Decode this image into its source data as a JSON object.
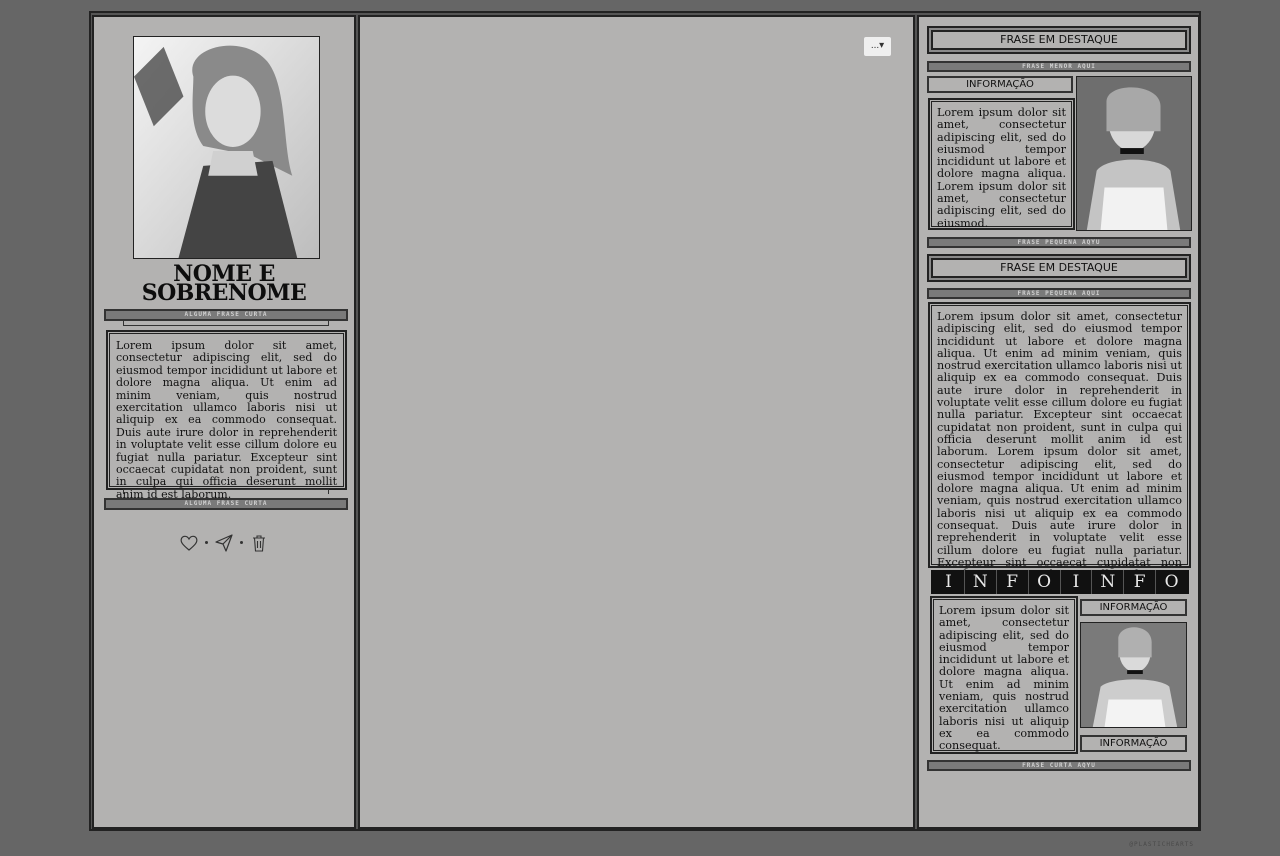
{
  "left_panel": {
    "name": "NOME E SOBRENOME",
    "top_bar_label": "ALGUMA FRASE CURTA",
    "bottom_bar_label": "ALGUMA FRASE CURTA",
    "bio": "Lorem ipsum dolor sit amet, consectetur adipiscing elit, sed do eiusmod tempor incididunt ut labore et dolore magna aliqua. Ut enim ad minim veniam, quis nostrud exercitation ullamco laboris nisi ut aliquip ex ea commodo consequat. Duis aute irure dolor in reprehenderit in voluptate velit esse cillum dolore eu fugiat nulla pariatur. Excepteur sint occaecat cupidatat non proident, sunt in culpa qui officia deserunt mollit anim id est laborum.",
    "actions": [
      {
        "icon": "heart-icon"
      },
      {
        "icon": "send-icon"
      },
      {
        "icon": "trash-icon"
      }
    ]
  },
  "center_panel": {
    "menu_button": "...▾"
  },
  "right_panel": {
    "feature_1": "FRASE EM DESTAQUE",
    "small_phrase_1": "FRASE MENOR AQUI",
    "info_label_1": "INFORMAÇÃO",
    "text_1": "Lorem ipsum dolor sit amet, consectetur adipiscing elit, sed do eiusmod tempor incididunt ut labore et dolore magna aliqua. Lorem ipsum dolor sit amet, consectetur adipiscing elit, sed do eiusmod.",
    "small_phrase_2": "FRASE PEQUENA AQYU",
    "feature_2": "FRASE EM DESTAQUE",
    "small_phrase_3": "FRASE PEQUENA AQUI",
    "text_2": "Lorem ipsum dolor sit amet, consectetur adipiscing elit, sed do eiusmod tempor incididunt ut labore et dolore magna aliqua. Ut enim ad minim veniam, quis nostrud exercitation ullamco laboris nisi ut aliquip ex ea commodo consequat. Duis aute irure dolor in reprehenderit in voluptate velit esse cillum dolore eu fugiat nulla pariatur. Excepteur sint occaecat cupidatat non proident, sunt in culpa qui officia deserunt mollit anim id est laborum. Lorem ipsum dolor sit amet, consectetur adipiscing elit, sed do eiusmod tempor incididunt ut labore et dolore magna aliqua. Ut enim ad minim veniam, quis nostrud exercitation ullamco laboris nisi ut aliquip ex ea commodo consequat. Duis aute irure dolor in reprehenderit in voluptate velit esse cillum dolore eu fugiat nulla pariatur. Excepteur sint occaecat cupidatat non proident, sunt in culpa qui officia deserunt mollit anim id est laborum.",
    "info_strip": [
      "I",
      "N",
      "F",
      "O",
      "I",
      "N",
      "F",
      "O"
    ],
    "text_3": "Lorem ipsum dolor sit amet, consectetur adipiscing elit, sed do eiusmod tempor incididunt ut labore et dolore magna aliqua. Ut enim ad minim veniam, quis nostrud exercitation ullamco laboris nisi ut aliquip ex ea commodo consequat.",
    "info_label_2": "INFORMAÇÃO",
    "info_label_3": "INFORMAÇÃO",
    "small_phrase_4": "FRASE CURTA AQYU"
  },
  "credit": "@PLASTICHEARTS",
  "colors": {
    "page_bg": "#666666",
    "panel_bg": "#b3b2b1",
    "border": "#222222",
    "bar": "#7a7a7a"
  }
}
